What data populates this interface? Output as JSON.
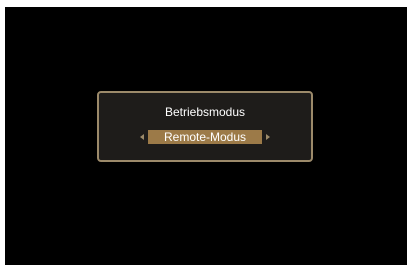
{
  "dialog": {
    "title": "Betriebsmodus",
    "selected_value": "Remote-Modus"
  },
  "icons": {
    "left": "triangle-left",
    "right": "triangle-right"
  },
  "colors": {
    "screen_background": "#000000",
    "dialog_border": "#9c8a6a",
    "dialog_background": "#1e1c1a",
    "selection_highlight": "#9c7a48",
    "text": "#ffffff"
  }
}
